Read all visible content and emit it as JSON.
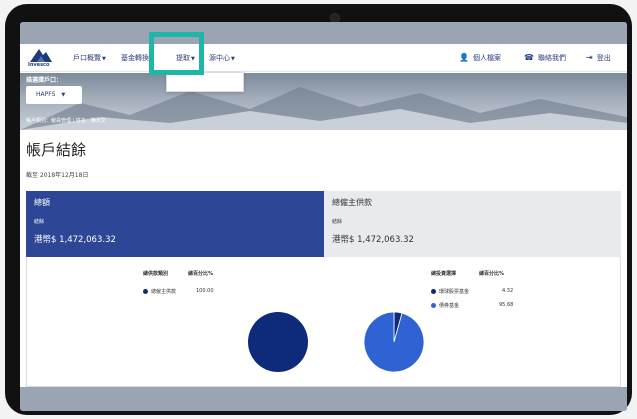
{
  "nav": {
    "logo_text": "Invesco",
    "menu": [
      {
        "label": "戶口概覽"
      },
      {
        "label": "基金轉換"
      },
      {
        "label": "提取"
      },
      {
        "label": "源中心"
      }
    ],
    "right": [
      {
        "label": "個人檔案",
        "icon": "user-icon"
      },
      {
        "label": "聯絡我們",
        "icon": "phone-icon"
      },
      {
        "label": "登出",
        "icon": "logout-icon"
      }
    ]
  },
  "hero": {
    "select_label": "描選擇戶口：",
    "account_value": "HAPFS",
    "info_text": "帳戶類別：僱員管理 | 姓名：陳大文"
  },
  "page": {
    "title": "帳戶結餘",
    "as_of": "截至 2018年12月18日"
  },
  "cards": {
    "left": {
      "title": "總額",
      "sub": "結餘",
      "amount": "港幣$ 1,472,063.32"
    },
    "right": {
      "title": "總僱主供款",
      "sub": "結餘",
      "amount": "港幣$ 1,472,063.32"
    }
  },
  "left_table": {
    "headers": [
      "總供款類別",
      "總百分比%"
    ],
    "rows": [
      {
        "label": "總僱主供款",
        "value": "100.00",
        "color": "#0e2a7a"
      }
    ]
  },
  "right_table": {
    "headers": [
      "總投資選擇",
      "總百分比%"
    ],
    "rows": [
      {
        "label": "環球股票基金",
        "value": "4.32",
        "color": "#0e2a7a"
      },
      {
        "label": "債券基金",
        "value": "95.68",
        "color": "#2f63d4"
      }
    ]
  },
  "colors": {
    "accent_navy": "#2d4796",
    "highlight": "#1fb5a8"
  }
}
